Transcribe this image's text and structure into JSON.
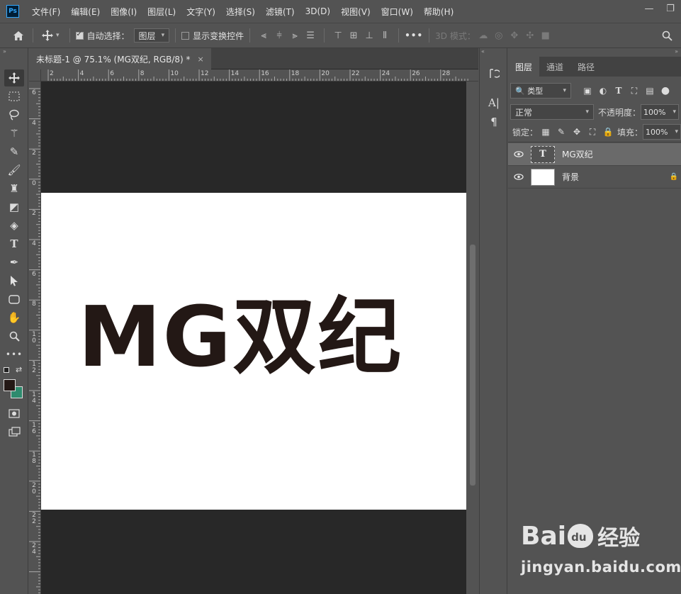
{
  "app": {
    "logo": "Ps"
  },
  "menu": [
    "文件(F)",
    "编辑(E)",
    "图像(I)",
    "图层(L)",
    "文字(Y)",
    "选择(S)",
    "滤镜(T)",
    "3D(D)",
    "视图(V)",
    "窗口(W)",
    "帮助(H)"
  ],
  "window_controls": {
    "minimize": "—",
    "restore": "❐"
  },
  "options_bar": {
    "auto_select_label": "自动选择：",
    "auto_select_checked": true,
    "auto_select_target": "图层",
    "show_transform_label": "显示变换控件",
    "show_transform_checked": false,
    "more": "•••",
    "mode_3d_label": "3D 模式："
  },
  "document": {
    "tab_title": "未标题-1 @ 75.1% (MG双纪, RGB/8) *",
    "close": "×",
    "canvas_text": "MG双纪",
    "ruler_h": [
      "2",
      "4",
      "6",
      "8",
      "10",
      "12",
      "14",
      "16",
      "18",
      "20",
      "22",
      "24",
      "26",
      "28"
    ],
    "ruler_v": [
      "6",
      "4",
      "2",
      "0",
      "2",
      "4",
      "6",
      "8",
      "10",
      "12",
      "14",
      "16",
      "18",
      "20",
      "22",
      "24"
    ]
  },
  "layers_panel": {
    "tabs": [
      "图层",
      "通道",
      "路径"
    ],
    "filter_kind": "类型",
    "blend_mode": "正常",
    "opacity_label": "不透明度：",
    "opacity_value": "100%",
    "lock_label": "锁定：",
    "fill_label": "填充：",
    "fill_value": "100%",
    "layers": [
      {
        "name": "MG双纪",
        "type": "text",
        "thumb": "T",
        "selected": true
      },
      {
        "name": "背景",
        "type": "background",
        "thumb": "",
        "selected": false
      }
    ]
  },
  "mini_strip": {
    "char_icon": "A|",
    "para_icon": "¶"
  },
  "watermark": {
    "logo_left": "Bai",
    "logo_paw": "du",
    "logo_right": "经验",
    "url": "jingyan.baidu.com"
  },
  "colors": {
    "foreground": "#231815",
    "background": "#2e8b6e",
    "text_fill": "#231815"
  }
}
